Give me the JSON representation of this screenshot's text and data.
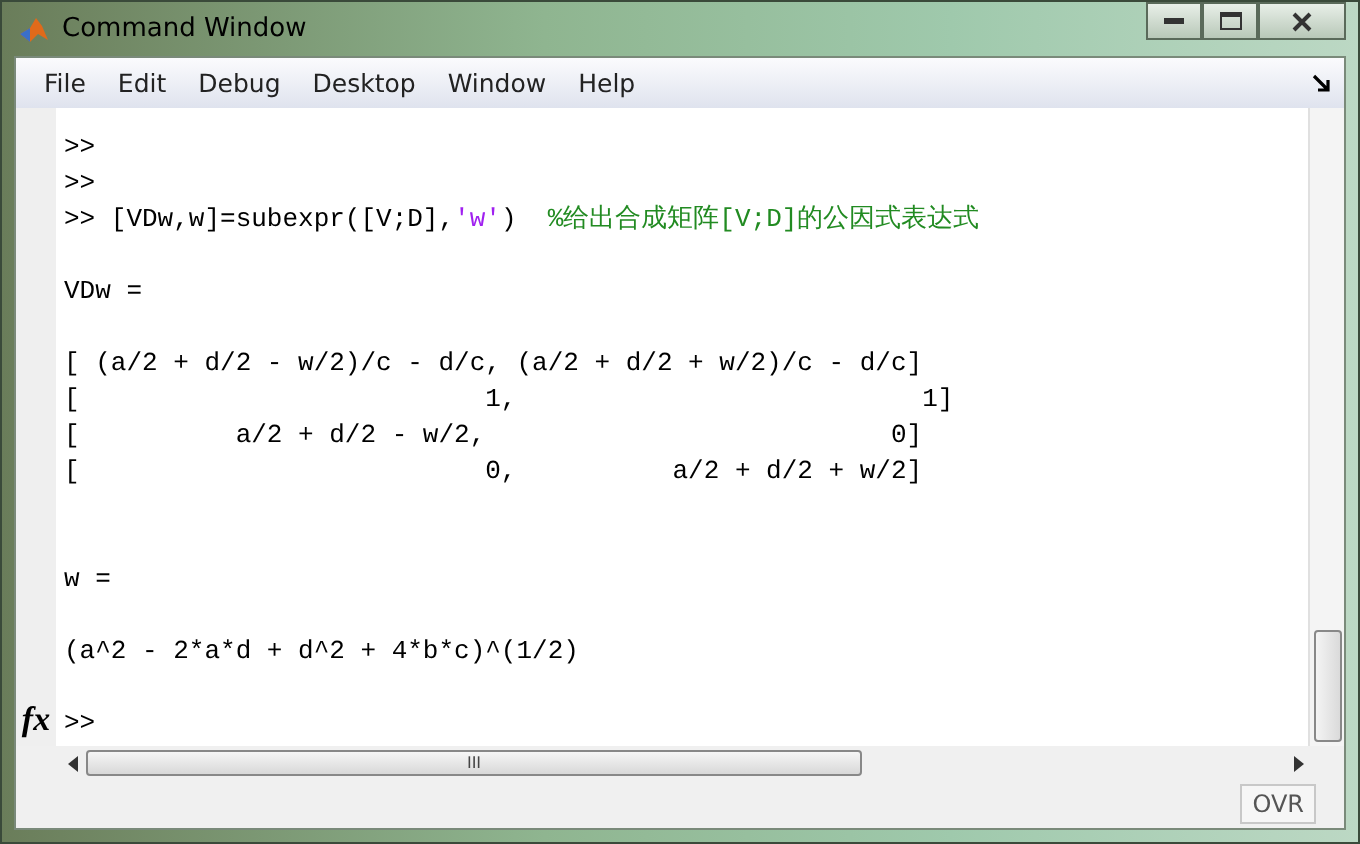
{
  "window": {
    "title": "Command Window"
  },
  "menu": [
    "File",
    "Edit",
    "Debug",
    "Desktop",
    "Window",
    "Help"
  ],
  "console": [
    {
      "kind": "output",
      "segments": [
        {
          "kind": "code",
          "text": ">>"
        }
      ]
    },
    {
      "kind": "output",
      "segments": [
        {
          "kind": "code",
          "text": ">>"
        }
      ]
    },
    {
      "kind": "output",
      "segments": [
        {
          "kind": "code",
          "text": ">> [VDw,w]=subexpr([V;D],"
        },
        {
          "kind": "string",
          "text": "'w'"
        },
        {
          "kind": "code",
          "text": ")  "
        },
        {
          "kind": "comment",
          "text": "%给出合成矩阵[V;D]的公因式表达式"
        }
      ]
    },
    {
      "kind": "blank"
    },
    {
      "kind": "output",
      "segments": [
        {
          "kind": "code",
          "text": "VDw ="
        }
      ]
    },
    {
      "kind": "blank"
    },
    {
      "kind": "output",
      "segments": [
        {
          "kind": "code",
          "text": "[ (a/2 + d/2 - w/2)/c - d/c, (a/2 + d/2 + w/2)/c - d/c]"
        }
      ]
    },
    {
      "kind": "output",
      "segments": [
        {
          "kind": "code",
          "text": "[                          1,                          1]"
        }
      ]
    },
    {
      "kind": "output",
      "segments": [
        {
          "kind": "code",
          "text": "[          a/2 + d/2 - w/2,                          0]"
        }
      ]
    },
    {
      "kind": "output",
      "segments": [
        {
          "kind": "code",
          "text": "[                          0,          a/2 + d/2 + w/2]"
        }
      ]
    },
    {
      "kind": "blank"
    },
    {
      "kind": "blank"
    },
    {
      "kind": "output",
      "segments": [
        {
          "kind": "code",
          "text": "w ="
        }
      ]
    },
    {
      "kind": "blank"
    },
    {
      "kind": "output",
      "segments": [
        {
          "kind": "code",
          "text": "(a^2 - 2*a*d + d^2 + 4*b*c)^(1/2)"
        }
      ]
    },
    {
      "kind": "blank"
    }
  ],
  "prompt": {
    "icon": "fx",
    "text": ">>"
  },
  "hscroll": {
    "grip": "III"
  },
  "status_bar": {
    "mode": "OVR"
  }
}
